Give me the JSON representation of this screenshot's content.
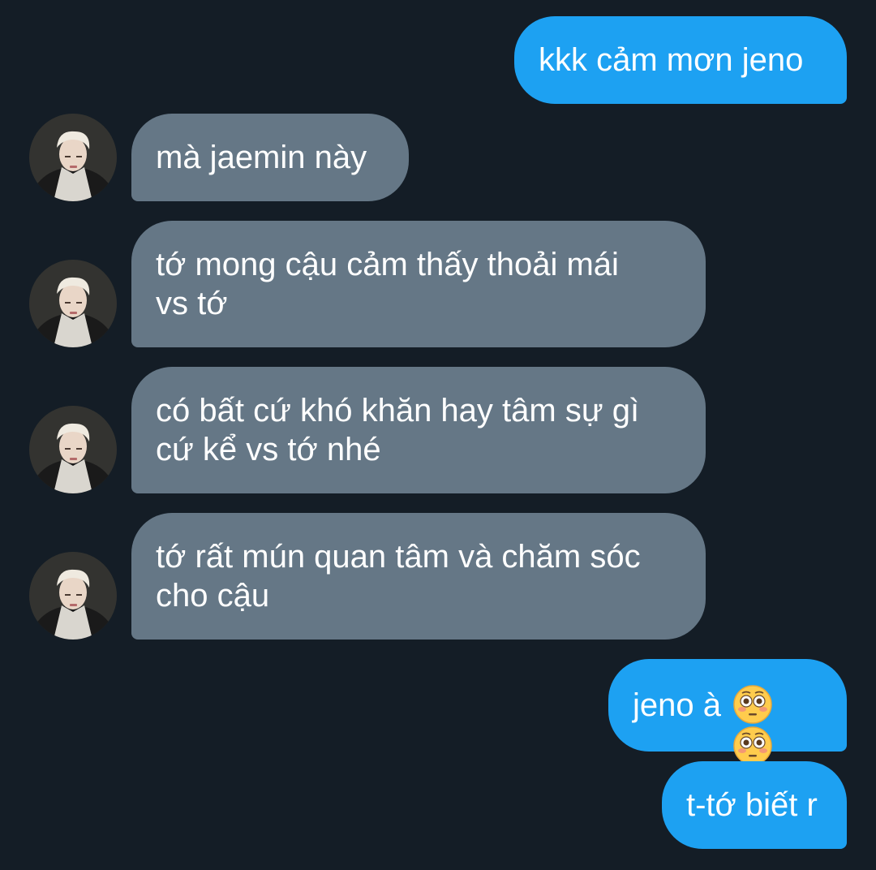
{
  "conversation": {
    "messages": [
      {
        "id": "m1",
        "direction": "outgoing",
        "text": "kkk cảm mơn jeno"
      },
      {
        "id": "m2",
        "direction": "incoming",
        "text": "mà jaemin này"
      },
      {
        "id": "m3",
        "direction": "incoming",
        "text": "tớ mong cậu cảm thấy thoải mái\nvs tớ"
      },
      {
        "id": "m4",
        "direction": "incoming",
        "text": "có bất cứ khó khăn hay tâm sự gì\ncứ kể vs tớ nhé"
      },
      {
        "id": "m5",
        "direction": "incoming",
        "text": "tớ rất mún quan tâm và chăm sóc\ncho cậu"
      },
      {
        "id": "m6",
        "direction": "outgoing",
        "text": "jeno à"
      },
      {
        "id": "m7",
        "direction": "outgoing",
        "text": "t-tớ biết r"
      }
    ],
    "m6_emojis": [
      "flushed-face-icon",
      "flushed-face-icon"
    ]
  },
  "colors": {
    "background": "#141d26",
    "outgoing_bubble": "#1da1f2",
    "incoming_bubble": "#657786",
    "text": "#ffffff"
  }
}
